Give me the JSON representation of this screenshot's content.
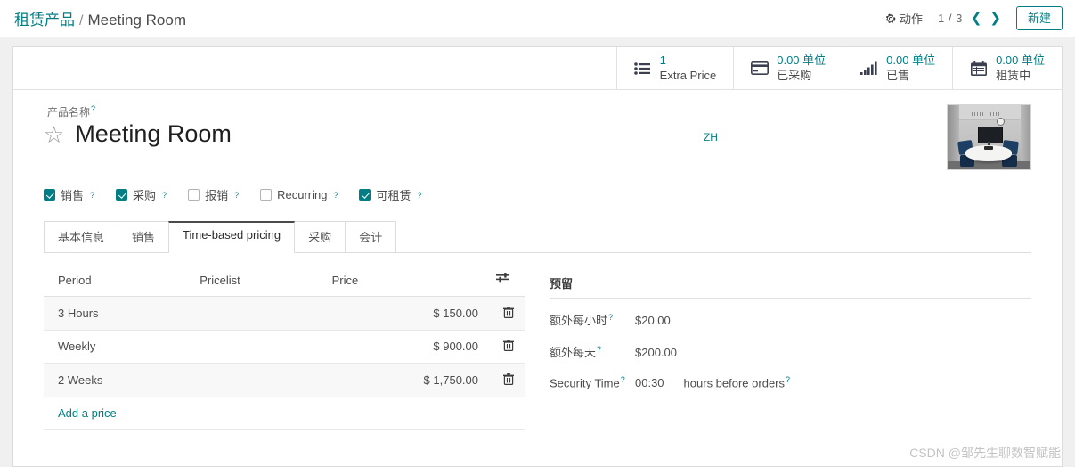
{
  "breadcrumb": {
    "parent": "租赁产品",
    "separator": "/",
    "current": "Meeting Room"
  },
  "control_panel": {
    "action_label": "动作",
    "action_icon": "gear-icon",
    "pager_text": "1 / 3",
    "prev_icon": "chevron-left-icon",
    "next_icon": "chevron-right-icon",
    "new_button": "新建"
  },
  "stat_buttons": [
    {
      "icon": "list-icon",
      "value": "1",
      "label": "Extra Price"
    },
    {
      "icon": "credit-card-icon",
      "value": "0.00 单位",
      "label": "已采购"
    },
    {
      "icon": "bar-chart-icon",
      "value": "0.00 单位",
      "label": "已售"
    },
    {
      "icon": "calendar-icon",
      "value": "0.00 单位",
      "label": "租赁中"
    }
  ],
  "product": {
    "name_label": "产品名称",
    "help_marker": "?",
    "name": "Meeting Room",
    "favorite_icon": "star-outline-icon",
    "language_badge": "ZH",
    "image_alt": "meeting-room-photo"
  },
  "checkboxes": [
    {
      "label": "销售",
      "checked": true
    },
    {
      "label": "采购",
      "checked": true
    },
    {
      "label": "报销",
      "checked": false
    },
    {
      "label": "Recurring",
      "checked": false
    },
    {
      "label": "可租赁",
      "checked": true
    }
  ],
  "tabs": [
    {
      "label": "基本信息",
      "active": false
    },
    {
      "label": "销售",
      "active": false
    },
    {
      "label": "Time-based pricing",
      "active": true
    },
    {
      "label": "采购",
      "active": false
    },
    {
      "label": "会计",
      "active": false
    }
  ],
  "pricing_table": {
    "columns": [
      "Period",
      "Pricelist",
      "Price"
    ],
    "options_icon": "sliders-icon",
    "rows": [
      {
        "period": "3 Hours",
        "pricelist": "",
        "price": "$ 150.00",
        "delete_icon": "trash-icon"
      },
      {
        "period": "Weekly",
        "pricelist": "",
        "price": "$ 900.00",
        "delete_icon": "trash-icon"
      },
      {
        "period": "2 Weeks",
        "pricelist": "",
        "price": "$ 1,750.00",
        "delete_icon": "trash-icon"
      }
    ],
    "add_row_label": "Add a price"
  },
  "reservation": {
    "section_title": "预留",
    "fields": [
      {
        "label": "额外每小时",
        "value": "$20.00",
        "suffix": ""
      },
      {
        "label": "额外每天",
        "value": "$200.00",
        "suffix": ""
      },
      {
        "label": "Security Time",
        "value": "00:30",
        "suffix": "hours before orders"
      }
    ]
  },
  "watermark": "CSDN @邹先生聊数智赋能",
  "colors": {
    "accent": "#017e84",
    "text": "#4c4c4c",
    "page_bg": "#f0f0f0"
  }
}
